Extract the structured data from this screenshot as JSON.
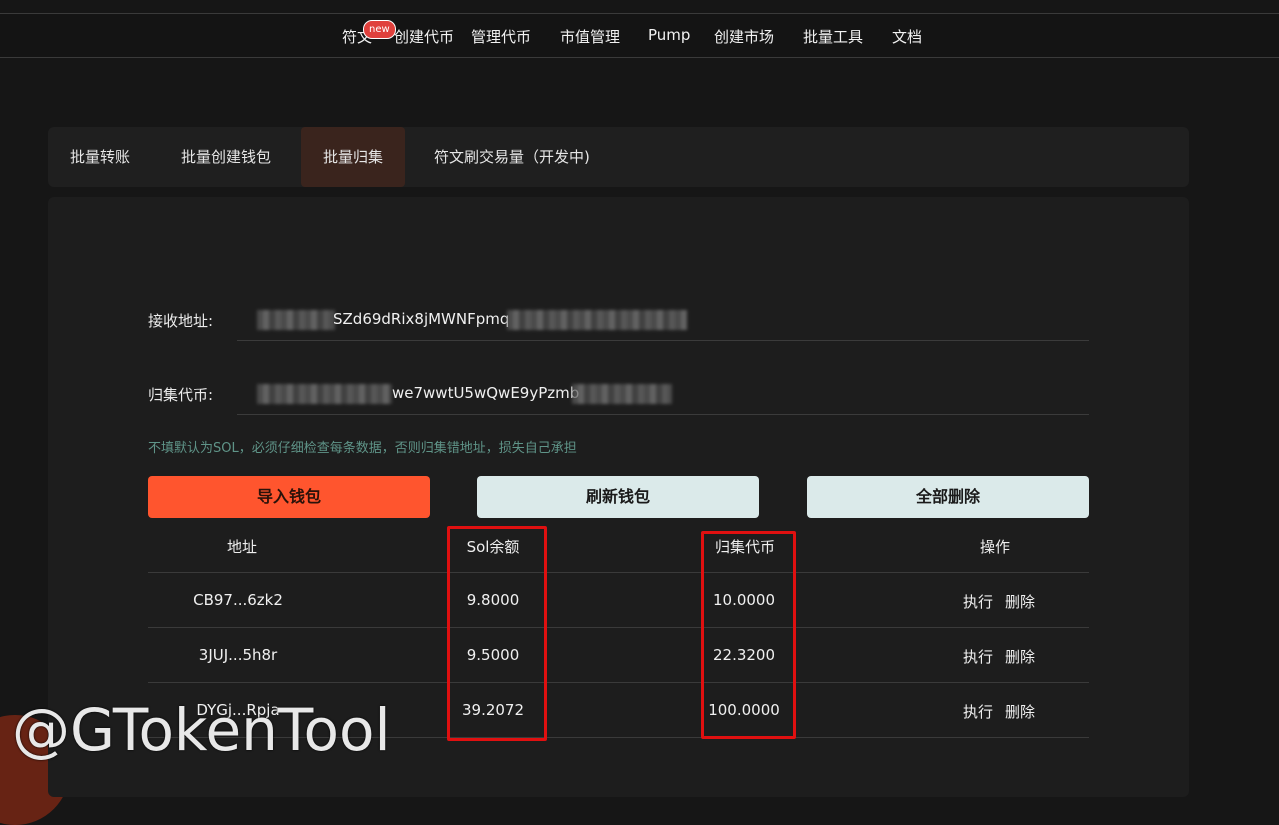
{
  "nav": {
    "items": [
      "符文",
      "创建代币",
      "管理代币",
      "市值管理",
      "Pump",
      "创建市场",
      "批量工具",
      "文档"
    ],
    "badge": "new"
  },
  "tabs": [
    "批量转账",
    "批量创建钱包",
    "批量归集",
    "符文刷交易量（开发中)"
  ],
  "active_tab": "批量归集",
  "form": {
    "receive_label": "接收地址:",
    "receive_value_visible": "SZd69dRix8jMWNFpmq",
    "token_label": "归集代币:",
    "token_value_visible": "we7wwtU5wQwE9yPzmb",
    "hint": "不填默认为SOL，必须仔细检查每条数据，否则归集错地址，损失自己承担"
  },
  "buttons": {
    "import": "导入钱包",
    "refresh": "刷新钱包",
    "delete_all": "全部删除"
  },
  "table": {
    "headers": [
      "地址",
      "Sol余额",
      "归集代币",
      "操作"
    ],
    "rows": [
      {
        "address": "CB97...6zk2",
        "sol": "9.8000",
        "token": "10.0000"
      },
      {
        "address": "3JUJ...5h8r",
        "sol": "9.5000",
        "token": "22.3200"
      },
      {
        "address": "DYGj...Rpja",
        "sol": "39.2072",
        "token": "100.0000"
      }
    ],
    "action_execute": "执行",
    "action_delete": "删除"
  },
  "watermark": "@GTokenTool",
  "colors": {
    "accent": "#ff552e",
    "light_button": "#dbeaea",
    "highlight_box": "#e01010",
    "hint": "#5f9488"
  }
}
